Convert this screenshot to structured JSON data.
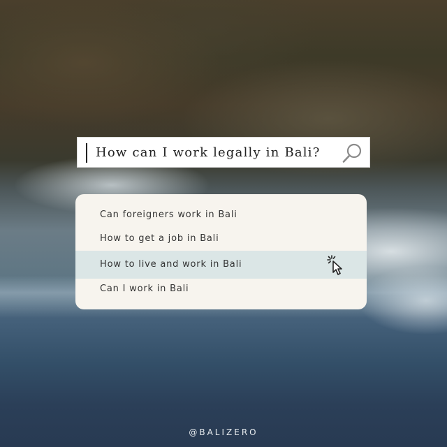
{
  "search": {
    "query": "How can I work legally in Bali?",
    "icon": "search-icon"
  },
  "suggestions": {
    "items": [
      {
        "label": "Can foreigners work in Bali"
      },
      {
        "label": "How to get a job in Bali"
      },
      {
        "label": "How to live and work in Bali"
      },
      {
        "label": "Can I work in Bali"
      }
    ],
    "highlighted_index": 2,
    "pointer_icon": "click-cursor-icon"
  },
  "footer": {
    "handle": "@BALIZERO"
  },
  "colors": {
    "box_background": "#f7f4ee",
    "highlight_background": "#dbe6e6",
    "text": "#333333"
  }
}
